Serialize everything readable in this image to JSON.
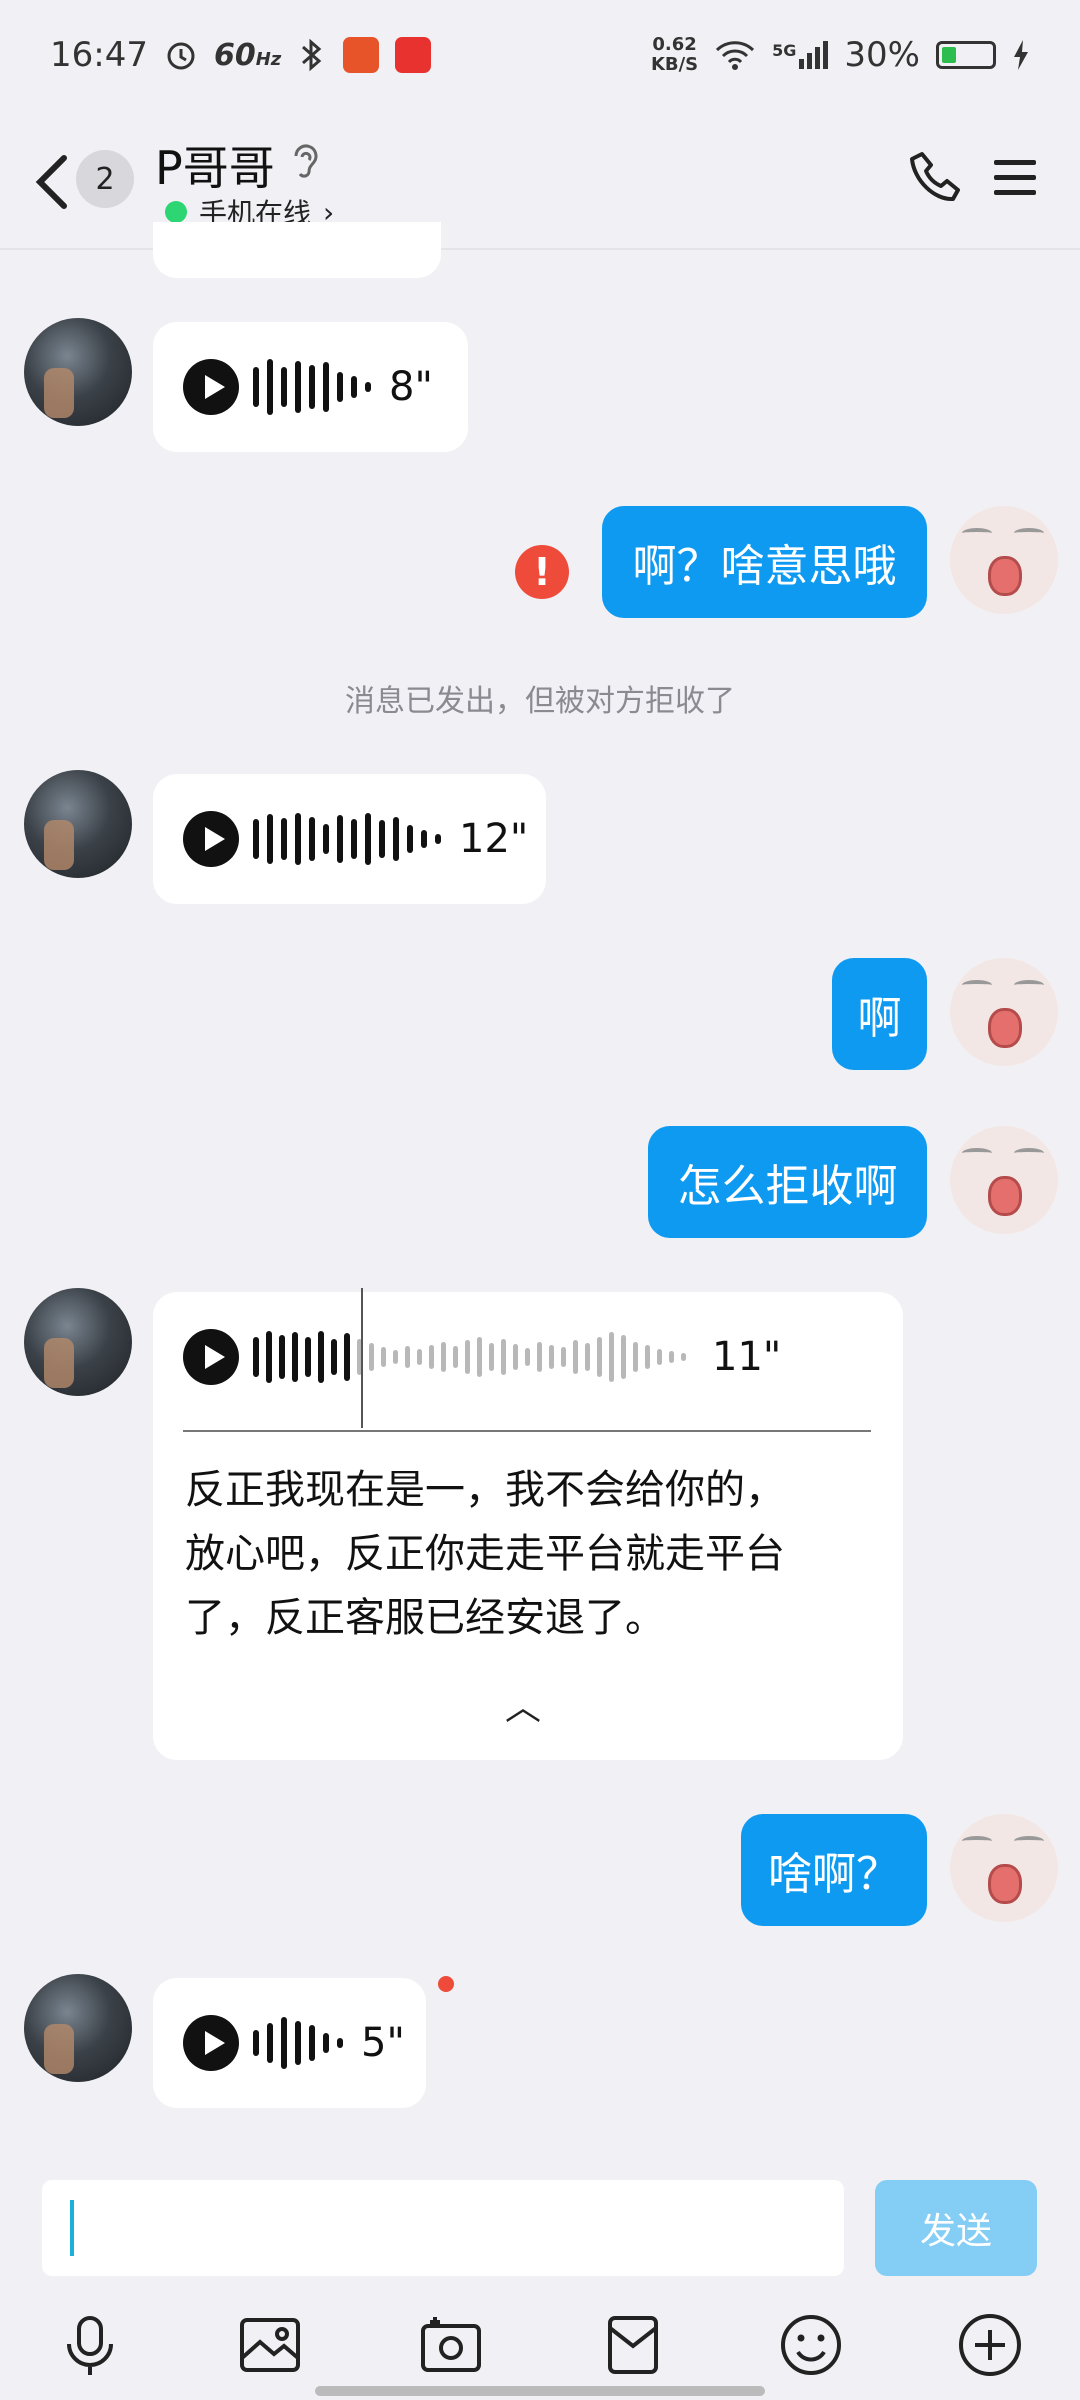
{
  "status_bar": {
    "time": "16:47",
    "refresh_rate": "60",
    "refresh_unit": "Hz",
    "net_speed_value": "0.62",
    "net_speed_unit": "KB/S",
    "network_type": "5G",
    "battery_percent": "30%",
    "battery_level": 0.3
  },
  "header": {
    "unread_count": "2",
    "contact_name": "P哥哥",
    "online_status": "手机在线",
    "online_chevron": "›"
  },
  "messages": {
    "voice_1_duration": "8\"",
    "out_1_text": "啊？啥意思哦",
    "out_1_error_glyph": "!",
    "system_notice": "消息已发出，但被对方拒收了",
    "voice_2_duration": "12\"",
    "out_2_text": "啊",
    "out_3_text": "怎么拒收啊",
    "voice_3_duration": "11\"",
    "voice_3_transcript_line1": "反正我现在是一，我不会给你的，",
    "voice_3_transcript_line2": "放心吧，反正你走走平台就走平台",
    "voice_3_transcript_line3": "了，反正客服已经安退了。",
    "voice_3_collapse_glyph": "︿",
    "out_4_text": "啥啊？",
    "voice_4_duration": "5\""
  },
  "input": {
    "value": "",
    "send_label": "发送"
  },
  "colors": {
    "outgoing_bubble": "#0f9af2",
    "send_button": "#84cdf5",
    "error": "#ee4b3a",
    "online": "#2ed573"
  },
  "icons": {
    "toolbar": [
      "mic-icon",
      "photo-icon",
      "camera-icon",
      "red-packet-icon",
      "emoji-icon",
      "plus-icon"
    ]
  }
}
